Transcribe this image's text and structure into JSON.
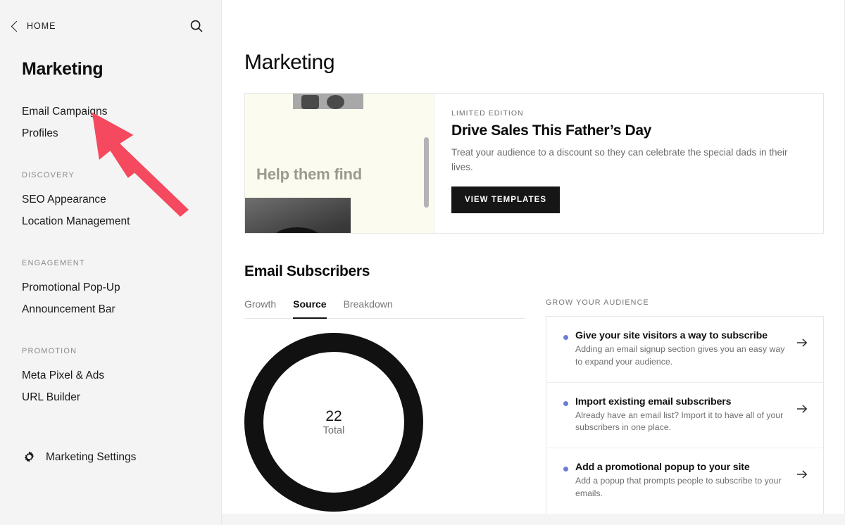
{
  "sidebar": {
    "back_label": "HOME",
    "search_icon": "search-icon",
    "back_icon": "chevron-left-icon",
    "title": "Marketing",
    "primary_items": [
      {
        "label": "Email Campaigns"
      },
      {
        "label": "Profiles"
      }
    ],
    "groups": [
      {
        "label": "DISCOVERY",
        "items": [
          {
            "label": "SEO Appearance"
          },
          {
            "label": "Location Management"
          }
        ]
      },
      {
        "label": "ENGAGEMENT",
        "items": [
          {
            "label": "Promotional Pop-Up"
          },
          {
            "label": "Announcement Bar"
          }
        ]
      },
      {
        "label": "PROMOTION",
        "items": [
          {
            "label": "Meta Pixel & Ads"
          },
          {
            "label": "URL Builder"
          }
        ]
      }
    ],
    "settings": {
      "label": "Marketing Settings",
      "icon": "gear-icon"
    }
  },
  "annotation": {
    "type": "arrow-pointer",
    "color": "#F4495E",
    "points_to": "Email Campaigns"
  },
  "main": {
    "page_title": "Marketing",
    "banner": {
      "eyebrow": "LIMITED EDITION",
      "title": "Drive Sales This Father’s Day",
      "description": "Treat your audience to a discount so they can celebrate the special dads in their lives.",
      "cta_label": "VIEW TEMPLATES",
      "preview_text": "Help them find",
      "preview_bg": "#FCFBEF"
    },
    "subscribers": {
      "section_title": "Email Subscribers",
      "tabs": [
        {
          "label": "Growth",
          "active": false
        },
        {
          "label": "Source",
          "active": true
        },
        {
          "label": "Breakdown",
          "active": false
        }
      ]
    },
    "grow": {
      "label": "GROW YOUR AUDIENCE",
      "bullet_color": "#6B7ED4",
      "items": [
        {
          "title": "Give your site visitors a way to subscribe",
          "description": "Adding an email signup section gives you an easy way to expand your audience.",
          "icon": "arrow-right-icon"
        },
        {
          "title": "Import existing email subscribers",
          "description": "Already have an email list? Import it to have all of your subscribers in one place.",
          "icon": "arrow-right-icon"
        },
        {
          "title": "Add a promotional popup to your site",
          "description": "Add a popup that prompts people to subscribe to your emails.",
          "icon": "arrow-right-icon"
        }
      ]
    }
  },
  "chart_data": {
    "type": "pie",
    "title": "Email Subscribers — Source",
    "center_value": "22",
    "center_label": "Total",
    "categories": [
      "Total"
    ],
    "values": [
      22
    ],
    "series": [
      {
        "name": "Total",
        "values": [
          22
        ]
      }
    ],
    "colors": [
      "#111111"
    ],
    "donut": true,
    "legend": "none",
    "grid": false
  }
}
